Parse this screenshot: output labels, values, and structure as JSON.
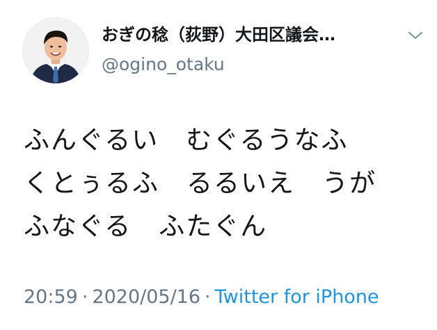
{
  "tweet": {
    "author": {
      "display_name": "おぎの稔（荻野）大田区議会…",
      "handle": "@ogino_otaku",
      "avatar": "avatar-photo"
    },
    "menu_icon": "chevron-down-icon",
    "text_lines": [
      "ふんぐるい　むぐるうなふ",
      "くとぅるふ　るるいえ　うが",
      "ふなぐる　ふたぐん"
    ],
    "meta": {
      "time": "20:59",
      "separator": "·",
      "date": "2020/05/16",
      "source": "Twitter for iPhone"
    },
    "colors": {
      "text": "#14171a",
      "secondary": "#657786",
      "link": "#1b95e0"
    }
  }
}
